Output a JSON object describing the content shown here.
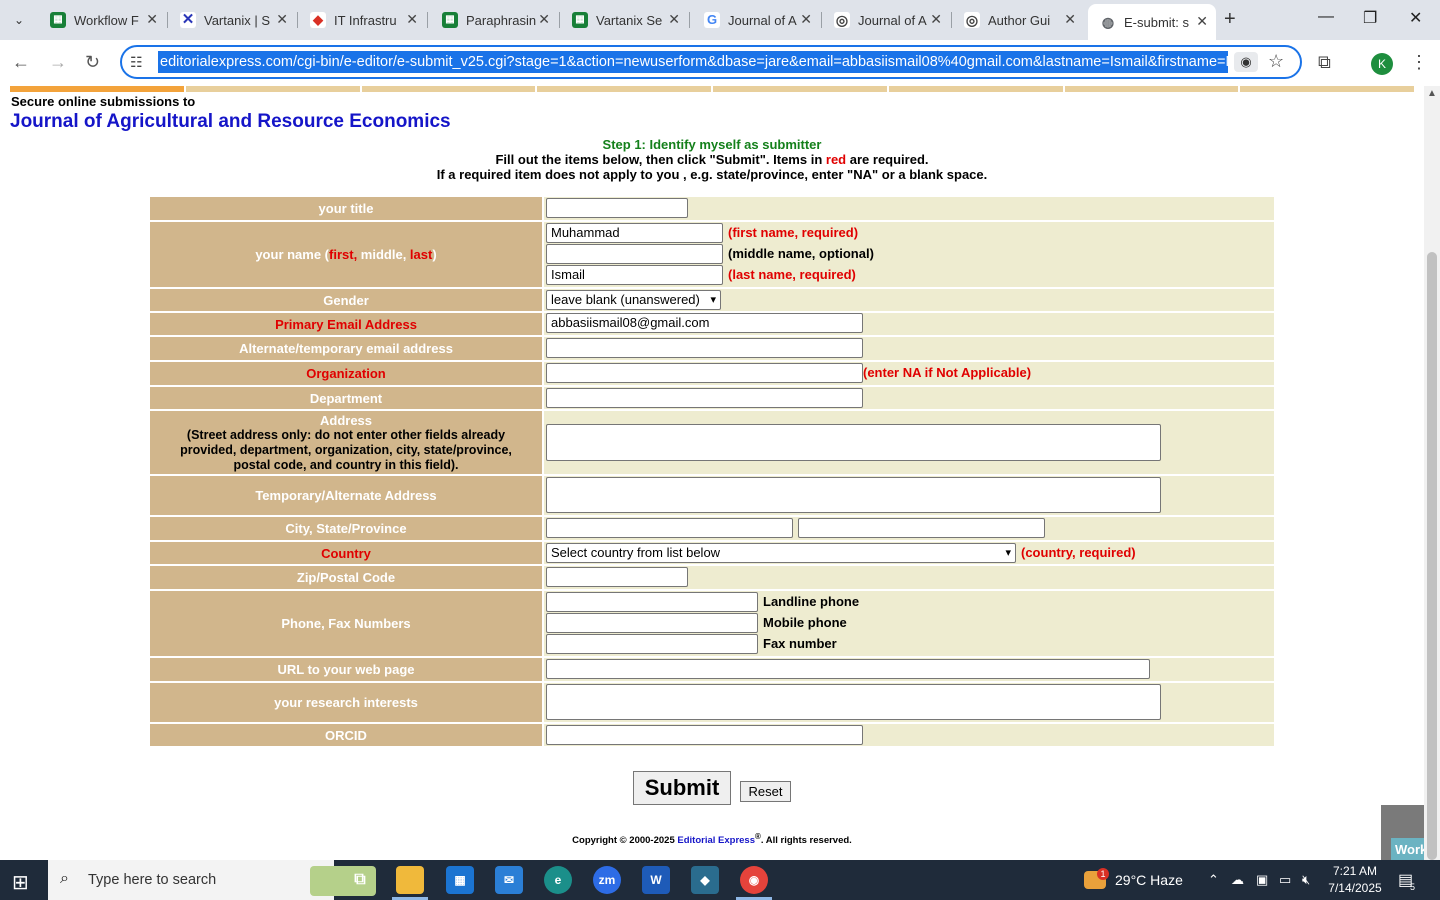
{
  "browser": {
    "tabs": [
      {
        "title": "Workflow F",
        "color": "#188038",
        "glyph": "▦"
      },
      {
        "title": "Vartanix | S",
        "color": "#2a36b8",
        "glyph": "✕"
      },
      {
        "title": "IT Infrastru",
        "color": "#d93025",
        "glyph": "◆"
      },
      {
        "title": "Paraphrasin",
        "color": "#188038",
        "glyph": "▦"
      },
      {
        "title": "Vartanix Se",
        "color": "#188038",
        "glyph": "▦"
      },
      {
        "title": "Journal of A",
        "color": "#4285f4",
        "glyph": "G"
      },
      {
        "title": "Journal of A",
        "color": "#444444",
        "glyph": "◎"
      },
      {
        "title": "Author Gui",
        "color": "#444444",
        "glyph": "◎"
      },
      {
        "title": "E-submit: s",
        "color": "#5f6368",
        "glyph": "◍"
      }
    ],
    "url": "editorialexpress.com/cgi-bin/e-editor/e-submit_v25.cgi?stage=1&action=newuserform&dbase=jare&email=abbasiismail08%40gmail.com&lastname=Ismail&firstname=Muhammad",
    "profile_initial": "K"
  },
  "page": {
    "secure_text": "Secure online submissions to",
    "journal_title": "Journal of Agricultural and Resource Economics",
    "step_title": "Step 1: Identify myself as submitter",
    "instr_a": "Fill out the items below, then click \"Submit\". Items in",
    "instr_red": "red",
    "instr_b": "are required.",
    "instr_2": "If a required item does not apply to you , e.g. state/province, enter \"NA\" or a blank space."
  },
  "form": {
    "title_label": "your title",
    "name_label_a": "your name (",
    "name_label_first": "first,",
    "name_label_middle": " middle, ",
    "name_label_last": "last",
    "name_label_b": ")",
    "first_name": "Muhammad",
    "first_note": "(first name, required)",
    "middle_note": "(middle name, optional)",
    "last_name": "Ismail",
    "last_note": "(last name, required)",
    "gender_label": "Gender",
    "gender_value": "leave blank (unanswered)",
    "email_label": "Primary Email Address",
    "email_value": "abbasiismail08@gmail.com",
    "alt_email_label": "Alternate/temporary email address",
    "org_label": "Organization",
    "org_note": "(enter NA if Not Applicable)",
    "dept_label": "Department",
    "address_label": "Address",
    "address_hint": "(Street address only: do not enter other fields already provided, department, organization, city, state/province, postal code, and country in this field).",
    "temp_address_label": "Temporary/Alternate Address",
    "city_label": "City, State/Province",
    "country_label": "Country",
    "country_value": "Select country from list below",
    "country_note": "(country, required)",
    "zip_label": "Zip/Postal Code",
    "phone_label": "Phone, Fax Numbers",
    "landline_note": "Landline phone",
    "mobile_note": "Mobile phone",
    "fax_note": "Fax number",
    "url_label": "URL to your web page",
    "research_label": "your research interests",
    "orcid_label": "ORCID",
    "submit_label": "Submit",
    "reset_label": "Reset"
  },
  "footer": {
    "copyright_a": "Copyright © 2000-2025",
    "copyright_link": "Editorial Express",
    "copyright_reg": "®",
    "copyright_b": ". All rights reserved.",
    "working": "Working"
  },
  "taskbar": {
    "search_placeholder": "Type here to search",
    "weather_badge": "1",
    "weather": "29°C  Haze",
    "time": "7:21 AM",
    "date": "7/14/2025",
    "notif_count": "5"
  }
}
